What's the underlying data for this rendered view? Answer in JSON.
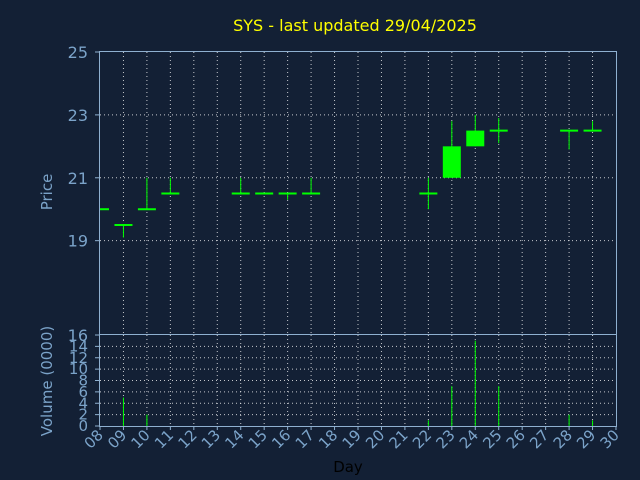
{
  "chart_data": [
    {
      "type": "candlestick",
      "title": "SYS - last updated 29/04/2025",
      "ylabel": "Price",
      "ylim": [
        16,
        25
      ],
      "yticks": [
        "25",
        "23",
        "21",
        "19",
        "16"
      ],
      "grid": true,
      "colors": {
        "title": "#ffff00",
        "candle": "#00ff00",
        "axis_text": "#7ba3c9",
        "background": "#132035"
      },
      "candles": [
        {
          "day": "08",
          "open": 20.0,
          "high": 20.0,
          "low": 20.0,
          "close": 20.0
        },
        {
          "day": "09",
          "open": 19.5,
          "high": 19.5,
          "low": 19.1,
          "close": 19.5
        },
        {
          "day": "10",
          "open": 20.0,
          "high": 21.0,
          "low": 20.0,
          "close": 20.0
        },
        {
          "day": "11",
          "open": 20.5,
          "high": 21.0,
          "low": 20.5,
          "close": 20.5
        },
        {
          "day": "14",
          "open": 20.5,
          "high": 21.0,
          "low": 20.5,
          "close": 20.5
        },
        {
          "day": "15",
          "open": 20.5,
          "high": 20.5,
          "low": 20.5,
          "close": 20.5
        },
        {
          "day": "16",
          "open": 20.5,
          "high": 20.5,
          "low": 20.3,
          "close": 20.5
        },
        {
          "day": "17",
          "open": 20.5,
          "high": 21.0,
          "low": 20.5,
          "close": 20.5
        },
        {
          "day": "22",
          "open": 20.5,
          "high": 21.0,
          "low": 20.0,
          "close": 20.5
        },
        {
          "day": "23",
          "open": 21.0,
          "high": 22.8,
          "low": 21.0,
          "close": 22.0
        },
        {
          "day": "24",
          "open": 22.0,
          "high": 23.0,
          "low": 22.0,
          "close": 22.5
        },
        {
          "day": "25",
          "open": 22.5,
          "high": 22.9,
          "low": 22.1,
          "close": 22.5
        },
        {
          "day": "28",
          "open": 22.5,
          "high": 22.5,
          "low": 21.9,
          "close": 22.5
        },
        {
          "day": "29",
          "open": 22.5,
          "high": 22.8,
          "low": 22.5,
          "close": 22.5
        }
      ]
    },
    {
      "type": "bar",
      "xlabel": "Day",
      "ylabel": "Volume (0000)",
      "ylim": [
        0,
        16
      ],
      "yticks": [
        "16",
        "14",
        "12",
        "10",
        "8",
        "6",
        "4",
        "2",
        "0"
      ],
      "grid": true,
      "categories": [
        "08",
        "09",
        "10",
        "11",
        "12",
        "13",
        "14",
        "15",
        "16",
        "17",
        "18",
        "19",
        "20",
        "21",
        "22",
        "23",
        "24",
        "25",
        "26",
        "27",
        "28",
        "29",
        "30"
      ],
      "values": [
        0,
        5,
        2,
        0,
        0,
        0,
        0,
        0,
        0,
        0,
        0,
        0,
        0,
        0,
        1,
        7,
        15,
        7,
        0,
        0,
        2,
        1,
        0
      ]
    }
  ]
}
